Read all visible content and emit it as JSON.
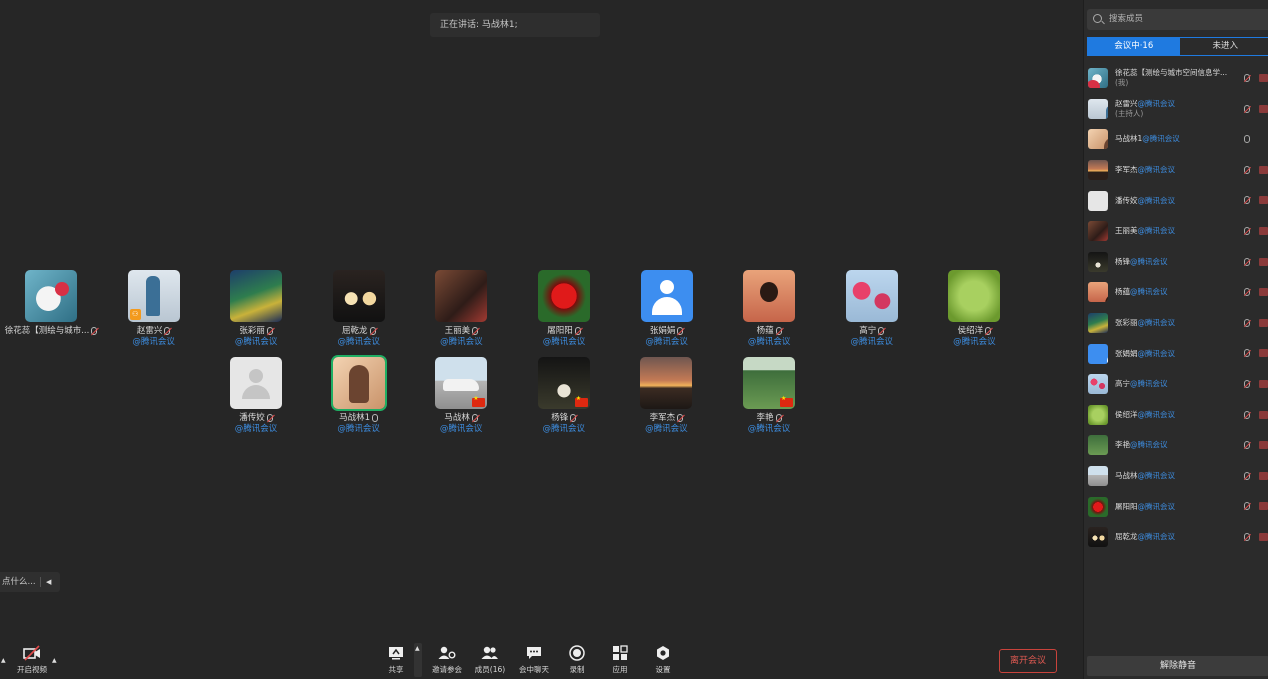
{
  "speaking": {
    "text": "正在讲话: 马战林1;"
  },
  "gallery": {
    "row1": [
      {
        "name": "徐花蕊【测绘与城市...",
        "org": "",
        "avatar": "a-bunny",
        "muted": true
      },
      {
        "name": "赵雷兴",
        "org": "@腾讯会议",
        "avatar": "a-sculpt",
        "muted": true,
        "host": true
      },
      {
        "name": "张彩丽",
        "org": "@腾讯会议",
        "avatar": "a-paint",
        "muted": true
      },
      {
        "name": "屈乾龙",
        "org": "@腾讯会议",
        "avatar": "a-stones",
        "muted": true
      },
      {
        "name": "王丽美",
        "org": "@腾讯会议",
        "avatar": "a-crowd",
        "muted": true
      },
      {
        "name": "屠阳阳",
        "org": "@腾讯会议",
        "avatar": "a-rose",
        "muted": true
      },
      {
        "name": "张娟娟",
        "org": "@腾讯会议",
        "avatar": "a-default",
        "muted": true
      },
      {
        "name": "杨蕴",
        "org": "@腾讯会议",
        "avatar": "a-boy",
        "muted": true
      },
      {
        "name": "高宁",
        "org": "@腾讯会议",
        "avatar": "a-blossom",
        "muted": true
      },
      {
        "name": "侯绍洋",
        "org": "@腾讯会议",
        "avatar": "a-green",
        "muted": true
      }
    ],
    "row2": [
      {
        "name": "潘传姣",
        "org": "@腾讯会议",
        "avatar": "a-grey",
        "muted": true
      },
      {
        "name": "马战林1",
        "org": "@腾讯会议",
        "avatar": "a-girl",
        "muted": false,
        "speaking": true
      },
      {
        "name": "马战林",
        "org": "@腾讯会议",
        "avatar": "a-car",
        "muted": true,
        "flag": true
      },
      {
        "name": "杨锋",
        "org": "@腾讯会议",
        "avatar": "a-night",
        "muted": true,
        "flag": true
      },
      {
        "name": "李军杰",
        "org": "@腾讯会议",
        "avatar": "a-sunset",
        "muted": true
      },
      {
        "name": "李艳",
        "org": "@腾讯会议",
        "avatar": "a-lotus",
        "muted": true,
        "flag": true
      }
    ]
  },
  "chat": {
    "placeholder": "点什么..."
  },
  "toolbar": {
    "video_label": "开启视频",
    "share_label": "共享",
    "invite_label": "邀请参会",
    "members_label": "成员(16)",
    "chat_label": "会中聊天",
    "record_label": "录制",
    "apps_label": "应用",
    "settings_label": "设置",
    "leave_label": "离开会议"
  },
  "sidebar": {
    "search_placeholder": "搜索成员",
    "tab_in_meeting": "会议中·16",
    "tab_not_joined": "未进入",
    "unmute_all": "解除静音",
    "members": [
      {
        "name": "徐花蕊【测绘与城市空间信息学...",
        "org": "",
        "role": "(我)",
        "avatar": "a-bunny",
        "muted": true
      },
      {
        "name": "赵雷兴",
        "org": "@腾讯会议",
        "role": "(主持人)",
        "avatar": "a-sculpt",
        "muted": true
      },
      {
        "name": "马战林1",
        "org": "@腾讯会议",
        "role": "",
        "avatar": "a-girl",
        "muted": false
      },
      {
        "name": "李军杰",
        "org": "@腾讯会议",
        "role": "",
        "avatar": "a-sunset-s",
        "muted": true
      },
      {
        "name": "潘传姣",
        "org": "@腾讯会议",
        "role": "",
        "avatar": "a-grey",
        "muted": true
      },
      {
        "name": "王丽美",
        "org": "@腾讯会议",
        "role": "",
        "avatar": "a-crowd",
        "muted": true
      },
      {
        "name": "杨锋",
        "org": "@腾讯会议",
        "role": "",
        "avatar": "a-night",
        "muted": true
      },
      {
        "name": "杨蕴",
        "org": "@腾讯会议",
        "role": "",
        "avatar": "a-boy",
        "muted": true
      },
      {
        "name": "张彩丽",
        "org": "@腾讯会议",
        "role": "",
        "avatar": "a-paint",
        "muted": true
      },
      {
        "name": "张娟娟",
        "org": "@腾讯会议",
        "role": "",
        "avatar": "a-default",
        "muted": true
      },
      {
        "name": "高宁",
        "org": "@腾讯会议",
        "role": "",
        "avatar": "a-blossom",
        "muted": true
      },
      {
        "name": "侯绍洋",
        "org": "@腾讯会议",
        "role": "",
        "avatar": "a-green",
        "muted": true
      },
      {
        "name": "李艳",
        "org": "@腾讯会议",
        "role": "",
        "avatar": "a-lotus-s",
        "muted": true
      },
      {
        "name": "马战林",
        "org": "@腾讯会议",
        "role": "",
        "avatar": "a-car",
        "muted": true
      },
      {
        "name": "屠阳阳",
        "org": "@腾讯会议",
        "role": "",
        "avatar": "a-rose",
        "muted": true
      },
      {
        "name": "屈乾龙",
        "org": "@腾讯会议",
        "role": "",
        "avatar": "a-stones",
        "muted": true
      }
    ]
  },
  "colors": {
    "accent": "#1f7ae0",
    "org_link": "#3d8de0",
    "leave": "#e05a52",
    "speaking_ring": "#1fae63"
  }
}
